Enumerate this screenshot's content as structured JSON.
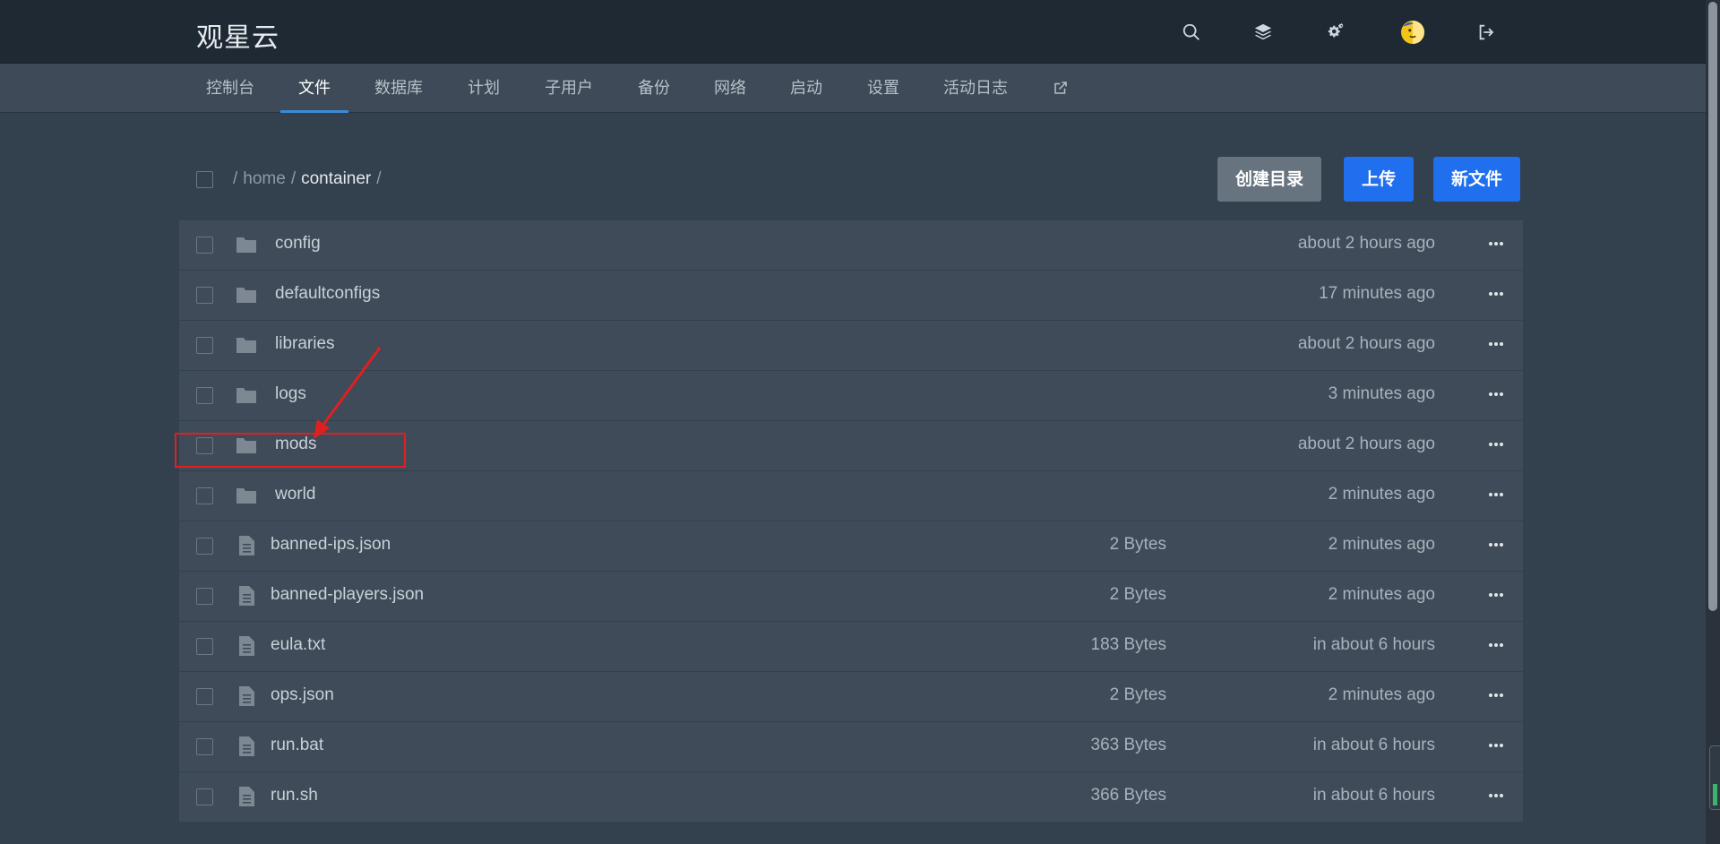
{
  "header": {
    "brand": "观星云",
    "icons": [
      "search-icon",
      "layers-icon",
      "gears-icon",
      "avatar",
      "logout-icon"
    ]
  },
  "nav": {
    "items": [
      {
        "label": "控制台"
      },
      {
        "label": "文件",
        "active": true
      },
      {
        "label": "数据库"
      },
      {
        "label": "计划"
      },
      {
        "label": "子用户"
      },
      {
        "label": "备份"
      },
      {
        "label": "网络"
      },
      {
        "label": "启动"
      },
      {
        "label": "设置"
      },
      {
        "label": "活动日志"
      }
    ],
    "external_icon": "external-link-icon"
  },
  "breadcrumb": {
    "sep1": "/",
    "home": "home",
    "sep2": "/",
    "current": "container",
    "sep3": "/"
  },
  "actions": {
    "create_dir": "创建目录",
    "upload": "上传",
    "new_file": "新文件"
  },
  "files": [
    {
      "type": "folder",
      "name": "config",
      "size": "",
      "modified": "about 2 hours ago"
    },
    {
      "type": "folder",
      "name": "defaultconfigs",
      "size": "",
      "modified": "17 minutes ago"
    },
    {
      "type": "folder",
      "name": "libraries",
      "size": "",
      "modified": "about 2 hours ago"
    },
    {
      "type": "folder",
      "name": "logs",
      "size": "",
      "modified": "3 minutes ago"
    },
    {
      "type": "folder",
      "name": "mods",
      "size": "",
      "modified": "about 2 hours ago"
    },
    {
      "type": "folder",
      "name": "world",
      "size": "",
      "modified": "2 minutes ago"
    },
    {
      "type": "file",
      "name": "banned-ips.json",
      "size": "2 Bytes",
      "modified": "2 minutes ago"
    },
    {
      "type": "file",
      "name": "banned-players.json",
      "size": "2 Bytes",
      "modified": "2 minutes ago"
    },
    {
      "type": "file",
      "name": "eula.txt",
      "size": "183 Bytes",
      "modified": "in about 6 hours"
    },
    {
      "type": "file",
      "name": "ops.json",
      "size": "2 Bytes",
      "modified": "2 minutes ago"
    },
    {
      "type": "file",
      "name": "run.bat",
      "size": "363 Bytes",
      "modified": "in about 6 hours"
    },
    {
      "type": "file",
      "name": "run.sh",
      "size": "366 Bytes",
      "modified": "in about 6 hours"
    }
  ],
  "colors": {
    "header_bg": "#1f2933",
    "nav_bg": "#3e4a57",
    "page_bg": "#33404d",
    "row_bg": "#3f4b58",
    "primary": "#1f6fef",
    "secondary": "#67737e",
    "annotation": "#e02020"
  }
}
